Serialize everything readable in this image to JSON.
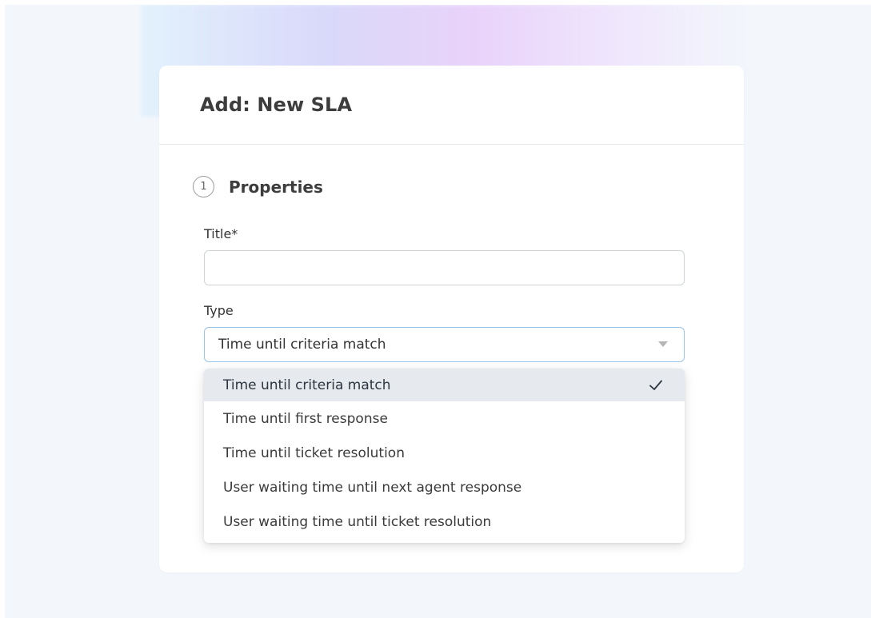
{
  "dialog": {
    "title": "Add: New SLA"
  },
  "step": {
    "number": "1",
    "label": "Properties"
  },
  "fields": {
    "title": {
      "label": "Title*",
      "value": ""
    },
    "type": {
      "label": "Type",
      "selected": "Time until criteria match"
    }
  },
  "dropdown": {
    "options": [
      {
        "label": "Time until criteria match",
        "selected": true
      },
      {
        "label": "Time until first response",
        "selected": false
      },
      {
        "label": "Time until ticket resolution",
        "selected": false
      },
      {
        "label": "User waiting time until next agent response",
        "selected": false
      },
      {
        "label": "User waiting time until ticket resolution",
        "selected": false
      }
    ]
  },
  "icons": {
    "check": "check-icon",
    "arrow": "caret-down-icon"
  },
  "colors": {
    "background": "#f3f7fc",
    "selected_option": "#e6e9ed",
    "focus_border": "#9ac3ea"
  }
}
